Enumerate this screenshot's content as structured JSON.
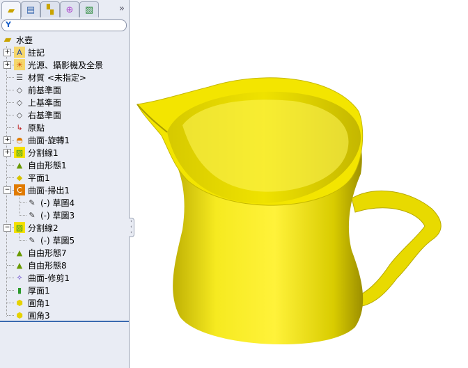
{
  "tabs": [
    {
      "name": "feature-manager",
      "icon": "parts-icon",
      "active": true
    },
    {
      "name": "property-manager",
      "icon": "properties-icon"
    },
    {
      "name": "configuration-manager",
      "icon": "configuration-icon"
    },
    {
      "name": "dimxpert-manager",
      "icon": "crosshair-icon"
    },
    {
      "name": "display-manager",
      "icon": "display-icon"
    }
  ],
  "more_label": "»",
  "filter_icon": "filter-icon",
  "tree": {
    "root": "水壺",
    "items": [
      {
        "label": "註記",
        "icon": "annotations-icon",
        "expand": "+"
      },
      {
        "label": "光源、攝影機及全景",
        "icon": "lights-icon",
        "expand": "+"
      },
      {
        "label": "材質 <未指定>",
        "icon": "material-icon"
      },
      {
        "label": "前基準面",
        "icon": "plane-icon"
      },
      {
        "label": "上基準面",
        "icon": "plane-icon"
      },
      {
        "label": "右基準面",
        "icon": "plane-icon"
      },
      {
        "label": "原點",
        "icon": "origin-icon"
      },
      {
        "label": "曲面-旋轉1",
        "icon": "revolve-surface-icon",
        "expand": "+"
      },
      {
        "label": "分割線1",
        "icon": "split-line-icon",
        "expand": "+"
      },
      {
        "label": "自由形態1",
        "icon": "freeform-icon"
      },
      {
        "label": "平面1",
        "icon": "plane-feature-icon"
      },
      {
        "label": "曲面-掃出1",
        "icon": "sweep-surface-icon",
        "expand": "−"
      },
      {
        "label": "(-) 草圖4",
        "icon": "sketch-icon",
        "child": true
      },
      {
        "label": "(-) 草圖3",
        "icon": "sketch-icon",
        "child": true
      },
      {
        "label": "分割線2",
        "icon": "split-line-icon",
        "expand": "−"
      },
      {
        "label": "(-) 草圖5",
        "icon": "sketch-icon",
        "child": true
      },
      {
        "label": "自由形態7",
        "icon": "freeform-icon"
      },
      {
        "label": "自由形態8",
        "icon": "freeform-icon"
      },
      {
        "label": "曲面-修剪1",
        "icon": "trim-surface-icon"
      },
      {
        "label": "厚面1",
        "icon": "thicken-icon"
      },
      {
        "label": "圓角1",
        "icon": "fillet-icon"
      },
      {
        "label": "圓角3",
        "icon": "fillet-icon"
      }
    ]
  },
  "model": {
    "color": "#f2e600"
  }
}
